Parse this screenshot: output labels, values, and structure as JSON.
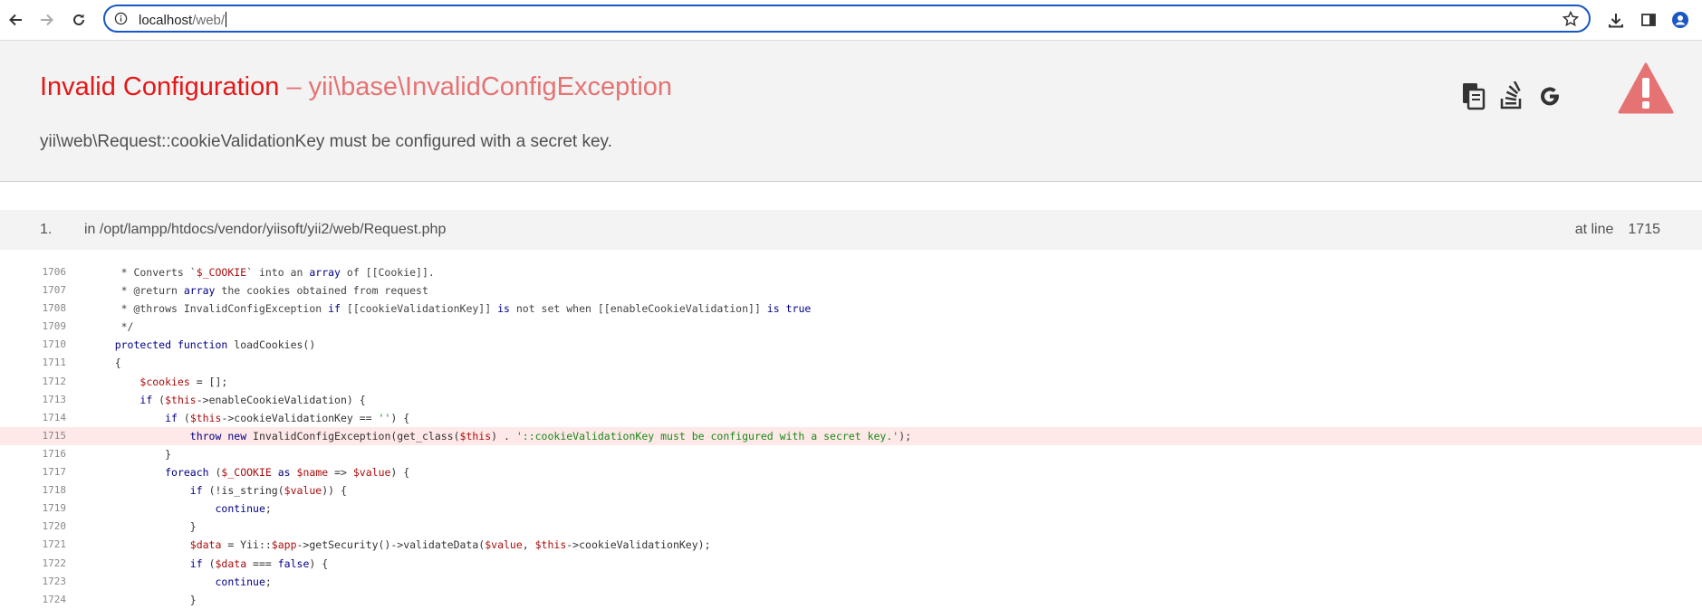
{
  "browser": {
    "url_host": "localhost",
    "url_path": "/web/"
  },
  "error": {
    "name": "Invalid Configuration",
    "separator": " – ",
    "class": "yii\\base\\InvalidConfigException",
    "message": "yii\\web\\Request::cookieValidationKey must be configured with a secret key."
  },
  "icons": [
    "copy-icon",
    "stack-overflow-icon",
    "google-icon",
    "warning-icon"
  ],
  "colors": {
    "accent": "#e51717",
    "highlight": "#ffe8e8",
    "alert": "#e57373",
    "url_border": "#1a56c4"
  },
  "call_stack": {
    "number": "1.",
    "file_text": "in /opt/lampp/htdocs/vendor/yiisoft/yii2/web/Request.php",
    "at_line_label": "at line",
    "line": "1715"
  },
  "code": {
    "highlight_line": "1715",
    "lines": [
      {
        "n": "1706",
        "t": "     * Converts `$_COOKIE` into an array of [[Cookie]]."
      },
      {
        "n": "1707",
        "t": "     * @return array the cookies obtained from request"
      },
      {
        "n": "1708",
        "t": "     * @throws InvalidConfigException if [[cookieValidationKey]] is not set when [[enableCookieValidation]] is true"
      },
      {
        "n": "1709",
        "t": "     */"
      },
      {
        "n": "1710",
        "t": "    protected function loadCookies()"
      },
      {
        "n": "1711",
        "t": "    {"
      },
      {
        "n": "1712",
        "t": "        $cookies = [];"
      },
      {
        "n": "1713",
        "t": "        if ($this->enableCookieValidation) {"
      },
      {
        "n": "1714",
        "t": "            if ($this->cookieValidationKey == '') {"
      },
      {
        "n": "1715",
        "t": "                throw new InvalidConfigException(get_class($this) . '::cookieValidationKey must be configured with a secret key.');"
      },
      {
        "n": "1716",
        "t": "            }"
      },
      {
        "n": "1717",
        "t": "            foreach ($_COOKIE as $name => $value) {"
      },
      {
        "n": "1718",
        "t": "                if (!is_string($value)) {"
      },
      {
        "n": "1719",
        "t": "                    continue;"
      },
      {
        "n": "1720",
        "t": "                }"
      },
      {
        "n": "1721",
        "t": "                $data = Yii::$app->getSecurity()->validateData($value, $this->cookieValidationKey);"
      },
      {
        "n": "1722",
        "t": "                if ($data === false) {"
      },
      {
        "n": "1723",
        "t": "                    continue;"
      },
      {
        "n": "1724",
        "t": "                }"
      }
    ]
  }
}
